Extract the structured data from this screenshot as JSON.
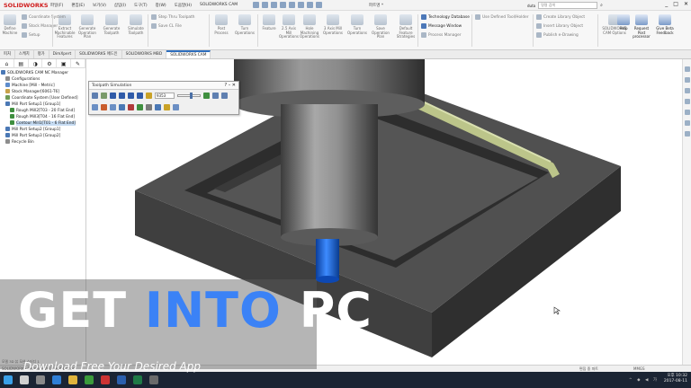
{
  "app": {
    "brand": "SOLIDWORKS",
    "menu": [
      "파일(F)",
      "편집(E)",
      "보기(V)",
      "삽입(I)",
      "도구(T)",
      "창(W)",
      "도움말(H)",
      "SOLIDWORKS CAM"
    ],
    "doc_title": "파트명 *",
    "user": "duta",
    "search_placeholder": "명령 검색",
    "window_controls": [
      "_",
      "□",
      "✕"
    ]
  },
  "ribbon": {
    "large_buttons": [
      {
        "label": "Define Machine",
        "dark": false
      },
      {
        "label": "Extract Machinable Features",
        "dark": false
      },
      {
        "label": "Generate Operation Plan",
        "dark": false
      },
      {
        "label": "Generate Toolpath",
        "dark": false
      },
      {
        "label": "Simulate Toolpath",
        "dark": false
      },
      {
        "label": "Post Process",
        "dark": false
      },
      {
        "label": "Turn Operations",
        "dark": false
      },
      {
        "label": "Feature",
        "dark": false
      },
      {
        "label": "2.5 Axis Mill Operations",
        "dark": false
      },
      {
        "label": "Hole Machining Operations",
        "dark": false
      },
      {
        "label": "3 Axis Mill Operations",
        "dark": false
      },
      {
        "label": "Turn Operations",
        "dark": false
      },
      {
        "label": "Save Operation Plan",
        "dark": false
      },
      {
        "label": "Default Feature Strategies",
        "dark": false
      },
      {
        "label": "SOLIDWORKS CAM Options",
        "dark": false
      },
      {
        "label": "Help",
        "dark": true
      },
      {
        "label": "Request Post processor",
        "dark": true
      },
      {
        "label": "Give Beta Feedback",
        "dark": true
      }
    ],
    "small_buttons": [
      {
        "label": "Coordinate System",
        "dark": false
      },
      {
        "label": "Stock Manager",
        "dark": false
      },
      {
        "label": "Setup",
        "dark": false
      },
      {
        "label": "Step Thru Toolpath",
        "dark": false
      },
      {
        "label": "Save CL File",
        "dark": false
      },
      {
        "label": "Technology Database",
        "dark": true
      },
      {
        "label": "Message Window",
        "dark": true
      },
      {
        "label": "Process Manager",
        "dark": false
      },
      {
        "label": "Use Defined Tool/Holder",
        "dark": false
      },
      {
        "label": "Create Library Object",
        "dark": false
      },
      {
        "label": "Insert Library Object",
        "dark": false
      },
      {
        "label": "Publish e-Drawing",
        "dark": false
      }
    ]
  },
  "tabs": [
    "피처",
    "스케치",
    "평가",
    "DimXpert",
    "SOLIDWORKS 애드인",
    "SOLIDWORKS MBD",
    "SOLIDWORKS CAM"
  ],
  "active_tab_index": 6,
  "tree": [
    {
      "label": "SOLIDWORKS CAM NC Manager",
      "indent": 0,
      "color": "#4a78b5",
      "selected": false
    },
    {
      "label": "Configurations",
      "indent": 1,
      "color": "#8d8d8d",
      "selected": false
    },
    {
      "label": "Machine [Mill - Metric]",
      "indent": 1,
      "color": "#5d8ccc",
      "selected": false
    },
    {
      "label": "Stock Manager[6061-T6]",
      "indent": 1,
      "color": "#c8a24a",
      "selected": false
    },
    {
      "label": "Coordinate System [User Defined]",
      "indent": 1,
      "color": "#6f9a55",
      "selected": false
    },
    {
      "label": "Mill Part Setup1 [Group1]",
      "indent": 1,
      "color": "#4a78b5",
      "selected": false
    },
    {
      "label": "Rough Mill2[T03 - 20 Flat End]",
      "indent": 2,
      "color": "#3f8f3f",
      "selected": false
    },
    {
      "label": "Rough Mill3[T04 - 16 Flat End]",
      "indent": 2,
      "color": "#3f8f3f",
      "selected": false
    },
    {
      "label": "Contour Mill1[T01 - 6 Flat End]",
      "indent": 2,
      "color": "#3f8f3f",
      "selected": true
    },
    {
      "label": "Mill Part Setup2 [Group1]",
      "indent": 1,
      "color": "#4a78b5",
      "selected": false
    },
    {
      "label": "Mill Part Setup3 [Group2]",
      "indent": 1,
      "color": "#4a78b5",
      "selected": false
    },
    {
      "label": "Recycle Bin",
      "indent": 1,
      "color": "#8d8d8d",
      "selected": false
    }
  ],
  "sim": {
    "title": "Toolpath Simulation",
    "controls": "? –  ✕",
    "speed_value": "9353",
    "progress": 0.55
  },
  "status": {
    "sheet_tabs": "모델   3D 뷰   모션 스터디 1",
    "left": "SOLIDWORKS Premium 2017 x64 Edition",
    "mid": "편집 중 파트",
    "units": "MMGS",
    "clock_time": "오후 10:32",
    "clock_date": "2017-08-11"
  },
  "watermark": {
    "title_part1": "GET ",
    "title_part2": "INTO",
    "title_part3": " PC",
    "subtitle": "Download Free Your Desired App"
  },
  "colors": {
    "taskbar": "#1b2433",
    "accent": "#3b82f6",
    "tool_blue": "#1060d8",
    "part_gray": "#4b4b4b"
  }
}
